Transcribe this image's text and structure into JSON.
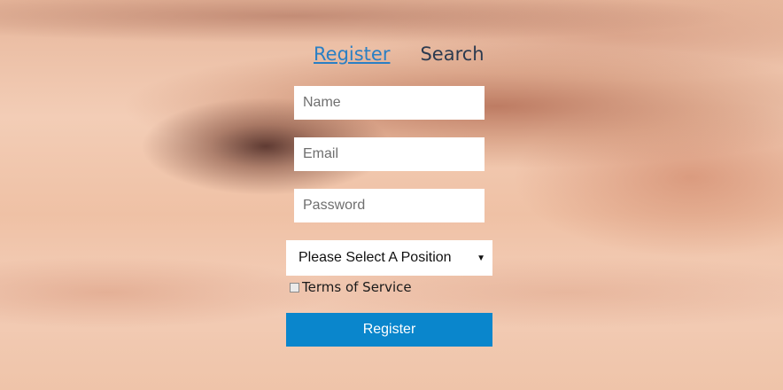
{
  "nav": {
    "register_label": "Register",
    "search_label": "Search"
  },
  "form": {
    "name_placeholder": "Name",
    "email_placeholder": "Email",
    "password_placeholder": "Password",
    "position_selected": "Please Select A Position",
    "terms_label": "Terms of Service",
    "terms_checked": false,
    "submit_label": "Register"
  },
  "colors": {
    "link": "#2a7fc4",
    "button": "#0a86cc",
    "background": "#f0c2a6"
  }
}
